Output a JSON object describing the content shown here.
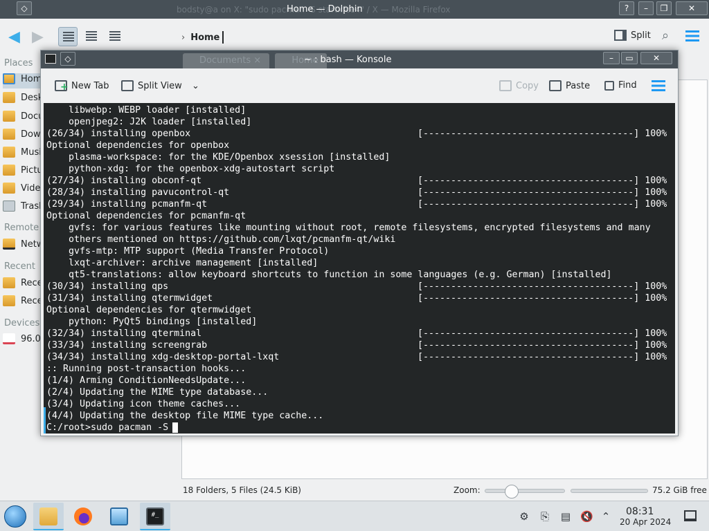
{
  "dolphin": {
    "ghost_title": "bodsty@a on X: \"sudo pacman -S startxfce4\" / X — Mozilla Firefox",
    "title": "Home — Dolphin",
    "menu_glyph": "◇",
    "help_glyph": "?",
    "minimize_glyph": "–",
    "maximize_glyph": "❐",
    "close_glyph": "✕",
    "breadcrumb": {
      "chevron": "›",
      "current": "Home"
    },
    "split_label": "Split",
    "places": {
      "sections": {
        "places": "Places",
        "remote": "Remote",
        "recent": "Recent",
        "devices": "Devices"
      },
      "items": [
        {
          "label": "Home",
          "icon": "home-folder-icon"
        },
        {
          "label": "Desktop",
          "icon": "desktop-folder-icon"
        },
        {
          "label": "Documents",
          "icon": "documents-folder-icon"
        },
        {
          "label": "Downloads",
          "icon": "downloads-folder-icon"
        },
        {
          "label": "Music",
          "icon": "music-folder-icon"
        },
        {
          "label": "Pictures",
          "icon": "pictures-folder-icon"
        },
        {
          "label": "Videos",
          "icon": "videos-folder-icon"
        },
        {
          "label": "Trash",
          "icon": "trash-icon"
        }
      ],
      "remote_items": [
        {
          "label": "Network",
          "icon": "network-folder-icon"
        }
      ],
      "recent_items": [
        {
          "label": "Recent Files",
          "icon": "recent-files-icon"
        },
        {
          "label": "Recent Locations",
          "icon": "recent-locations-icon"
        }
      ],
      "device_items": [
        {
          "label": "96.0 GiB Hard Drive",
          "icon": "hard-drive-icon"
        }
      ]
    },
    "status": {
      "summary": "18 Folders, 5 Files (24.5 KiB)",
      "zoom_label": "Zoom:",
      "zoom_level": 0.3,
      "free_space": "75.2 GiB free"
    }
  },
  "konsole": {
    "title": "~ : bash — Konsole",
    "ghost_tabs": [
      "Documents",
      "Home"
    ],
    "ghost_tab_close": "×",
    "toolbar": {
      "new_tab": "New Tab",
      "split_view": "Split View",
      "copy": "Copy",
      "paste": "Paste",
      "find": "Find",
      "split_view_menu_glyph": "⌄"
    },
    "minimize_glyph": "–",
    "maximize_glyph": "▭",
    "close_glyph": "✕",
    "terminal_lines": [
      {
        "text": "    libwebp: WEBP loader [installed]"
      },
      {
        "text": "    openjpeg2: J2K loader [installed]"
      },
      {
        "text": "(26/34) installing openbox",
        "bar": "[--------------------------------------] 100%"
      },
      {
        "text": "Optional dependencies for openbox"
      },
      {
        "text": "    plasma-workspace: for the KDE/Openbox xsession [installed]"
      },
      {
        "text": "    python-xdg: for the openbox-xdg-autostart script"
      },
      {
        "text": "(27/34) installing obconf-qt",
        "bar": "[--------------------------------------] 100%"
      },
      {
        "text": "(28/34) installing pavucontrol-qt",
        "bar": "[--------------------------------------] 100%"
      },
      {
        "text": "(29/34) installing pcmanfm-qt",
        "bar": "[--------------------------------------] 100%"
      },
      {
        "text": "Optional dependencies for pcmanfm-qt"
      },
      {
        "text": "    gvfs: for various features like mounting without root, remote filesystems, encrypted filesystems and many"
      },
      {
        "text": "    others mentioned on https://github.com/lxqt/pcmanfm-qt/wiki"
      },
      {
        "text": "    gvfs-mtp: MTP support (Media Transfer Protocol)"
      },
      {
        "text": "    lxqt-archiver: archive management [installed]"
      },
      {
        "text": "    qt5-translations: allow keyboard shortcuts to function in some languages (e.g. German) [installed]"
      },
      {
        "text": "(30/34) installing qps",
        "bar": "[--------------------------------------] 100%"
      },
      {
        "text": "(31/34) installing qtermwidget",
        "bar": "[--------------------------------------] 100%"
      },
      {
        "text": "Optional dependencies for qtermwidget"
      },
      {
        "text": "    python: PyQt5 bindings [installed]"
      },
      {
        "text": "(32/34) installing qterminal",
        "bar": "[--------------------------------------] 100%"
      },
      {
        "text": "(33/34) installing screengrab",
        "bar": "[--------------------------------------] 100%"
      },
      {
        "text": "(34/34) installing xdg-desktop-portal-lxqt",
        "bar": "[--------------------------------------] 100%"
      },
      {
        "text": ":: Running post-transaction hooks..."
      },
      {
        "text": "(1/4) Arming ConditionNeedsUpdate..."
      },
      {
        "text": "(2/4) Updating the MIME type database..."
      },
      {
        "text": "(3/4) Updating icon theme caches..."
      },
      {
        "text": "(4/4) Updating the desktop file MIME type cache..."
      }
    ],
    "prompt": "C:/root>sudo pacman -S"
  },
  "taskbar": {
    "konsole_glyph": "#_",
    "tray_glyphs": {
      "network": "⚙",
      "clipboard": "⎘",
      "notes": "▤",
      "volume": "🔇",
      "expand": "⌃"
    },
    "clock_time": "08:31",
    "clock_date": "20 Apr 2024"
  },
  "colors": {
    "accent": "#3daee9",
    "titlebar": "#475057",
    "terminal_bg": "#232627",
    "hamburger": "#1d99f3"
  }
}
